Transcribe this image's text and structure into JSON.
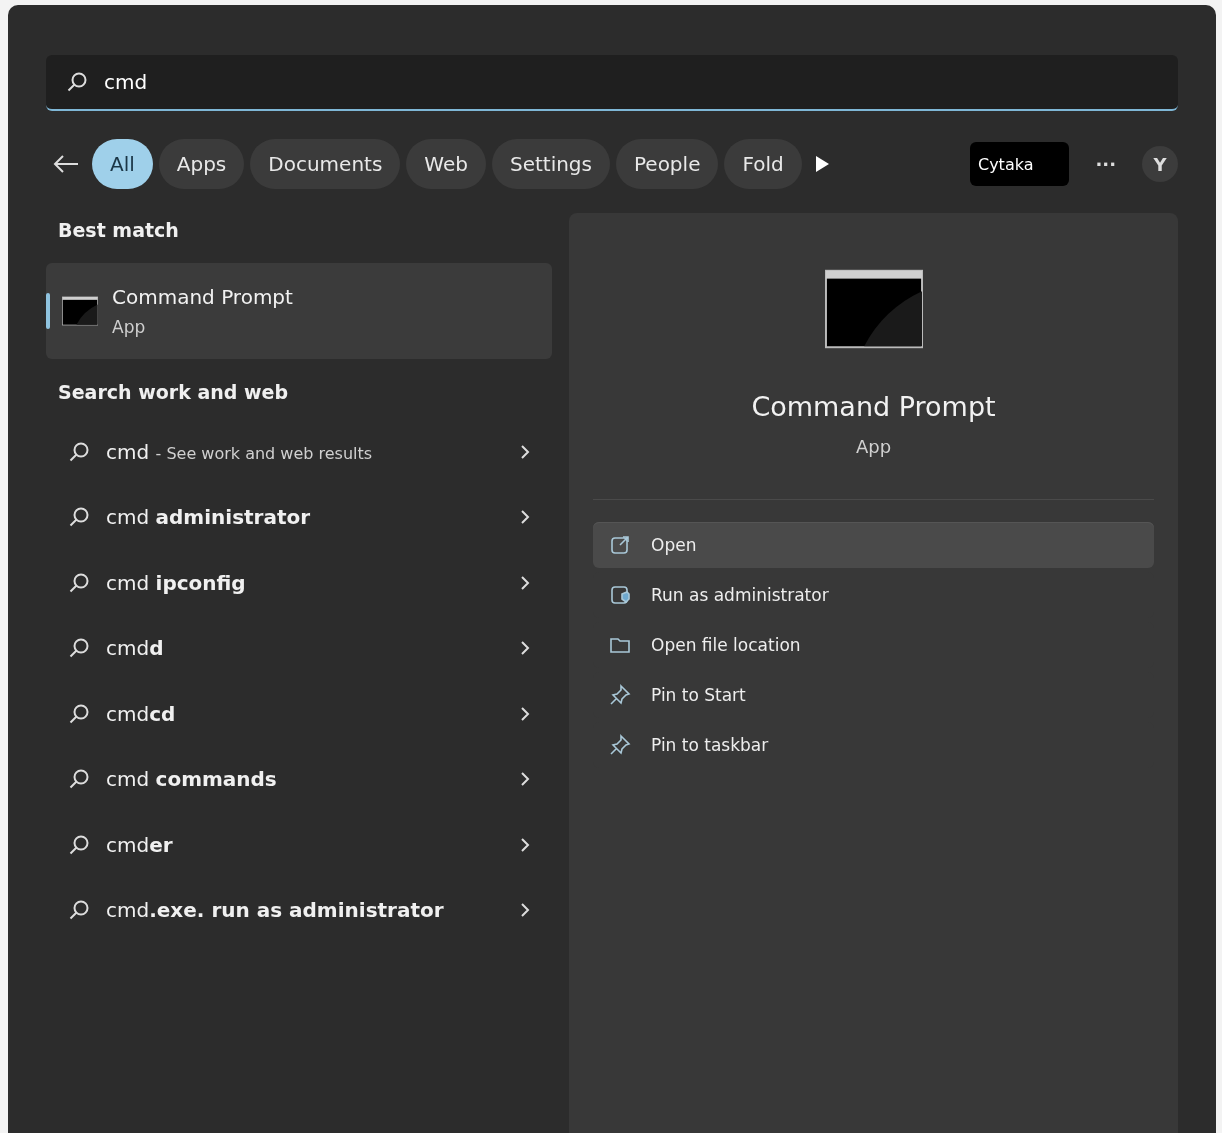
{
  "search": {
    "value": "cmd"
  },
  "filters": [
    {
      "label": "All",
      "selected": true
    },
    {
      "label": "Apps",
      "selected": false
    },
    {
      "label": "Documents",
      "selected": false
    },
    {
      "label": "Web",
      "selected": false
    },
    {
      "label": "Settings",
      "selected": false
    },
    {
      "label": "People",
      "selected": false
    },
    {
      "label": "Fold",
      "selected": false
    }
  ],
  "account": {
    "label": "Cytaka",
    "more": "···",
    "avatar": "Y"
  },
  "best_match": {
    "heading": "Best match",
    "title": "Command Prompt",
    "subtitle": "App",
    "selected": true
  },
  "suggestions": {
    "heading": "Search work and web",
    "items": [
      {
        "text": "cmd",
        "hint": "- See work and web results"
      },
      {
        "text": "cmd **administrator**"
      },
      {
        "text": "cmd **ipconfig**"
      },
      {
        "text": "cmd**d**"
      },
      {
        "text": "cmd**cd**"
      },
      {
        "text": "cmd **commands**"
      },
      {
        "text": "cmd**er**"
      },
      {
        "text": "cmd**.exe. run as administrator**"
      }
    ]
  },
  "details": {
    "title": "Command Prompt",
    "subtitle": "App",
    "actions": [
      {
        "kind": "open",
        "label": "Open",
        "selected": true
      },
      {
        "kind": "admin",
        "label": "Run as administrator",
        "selected": false
      },
      {
        "kind": "folder",
        "label": "Open file location",
        "selected": false
      },
      {
        "kind": "pin",
        "label": "Pin to Start",
        "selected": false
      },
      {
        "kind": "pin",
        "label": "Pin to taskbar",
        "selected": false
      }
    ]
  }
}
